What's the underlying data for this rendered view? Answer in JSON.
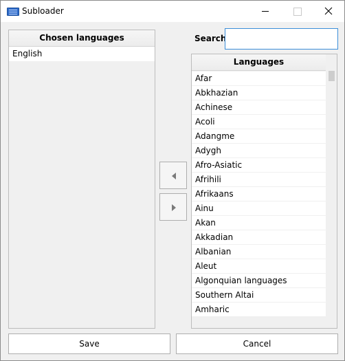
{
  "window": {
    "title": "Subloader",
    "icon": "keyboard-icon"
  },
  "chosen": {
    "header": "Chosen languages",
    "items": [
      "English"
    ]
  },
  "search": {
    "label": "Search:",
    "value": "",
    "placeholder": ""
  },
  "languages": {
    "header": "Languages",
    "items": [
      "Afar",
      "Abkhazian",
      "Achinese",
      "Acoli",
      "Adangme",
      "Adygh",
      "Afro-Asiatic",
      "Afrihili",
      "Afrikaans",
      "Ainu",
      "Akan",
      "Akkadian",
      "Albanian",
      "Aleut",
      "Algonquian languages",
      "Southern Altai",
      "Amharic"
    ]
  },
  "buttons": {
    "move_left_icon": "triangle-left-icon",
    "move_right_icon": "triangle-right-icon",
    "save": "Save",
    "cancel": "Cancel"
  },
  "colors": {
    "accent": "#3a8dd8",
    "background": "#f0f0f0",
    "list_bg": "#ffffff"
  }
}
